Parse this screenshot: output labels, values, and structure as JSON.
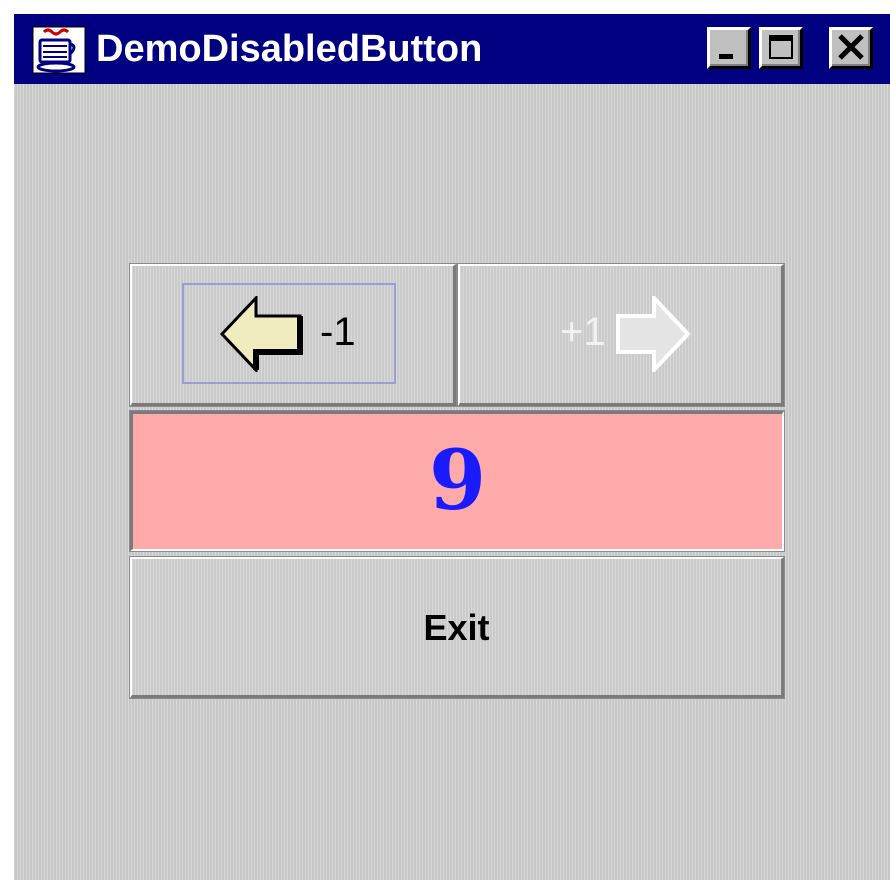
{
  "window": {
    "title": "DemoDisabledButton",
    "controls": {
      "minimize_icon": "minimize-icon",
      "maximize_icon": "maximize-icon",
      "close_icon": "close-icon"
    }
  },
  "buttons": {
    "decrement": {
      "label": "-1",
      "icon": "left-arrow-icon",
      "enabled": true,
      "focused": true
    },
    "increment": {
      "label": "+1",
      "icon": "right-arrow-icon",
      "enabled": false
    },
    "exit": {
      "label": "Exit"
    }
  },
  "counter": {
    "value": "9"
  },
  "colors": {
    "titlebar": "#000080",
    "counter_background": "#ffaaaa",
    "counter_text": "#1a1aff",
    "arrow_fill": "#f0ecc0",
    "disabled_text": "#f2f2f2"
  }
}
